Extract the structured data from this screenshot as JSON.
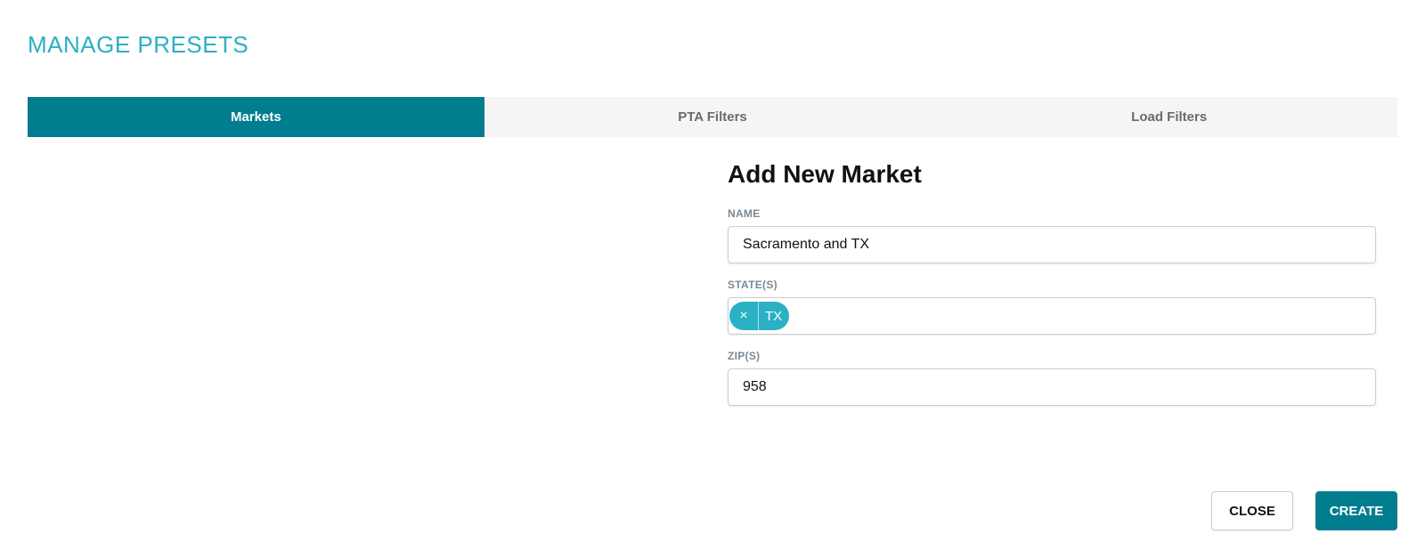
{
  "modal": {
    "title": "MANAGE PRESETS"
  },
  "tabs": [
    {
      "label": "Markets",
      "active": true
    },
    {
      "label": "PTA Filters",
      "active": false
    },
    {
      "label": "Load Filters",
      "active": false
    }
  ],
  "form": {
    "heading": "Add New Market",
    "name": {
      "label": "NAME",
      "value": "Sacramento and TX"
    },
    "states": {
      "label": "STATE(S)",
      "tags": [
        {
          "label": "TX",
          "remove_glyph": "×"
        }
      ]
    },
    "zips": {
      "label": "ZIP(S)",
      "value": "958"
    }
  },
  "actions": {
    "close_label": "CLOSE",
    "create_label": "CREATE"
  },
  "colors": {
    "accent": "#2bb0c4",
    "primary": "#007d8f",
    "tab_inactive_bg": "#f5f5f5"
  }
}
